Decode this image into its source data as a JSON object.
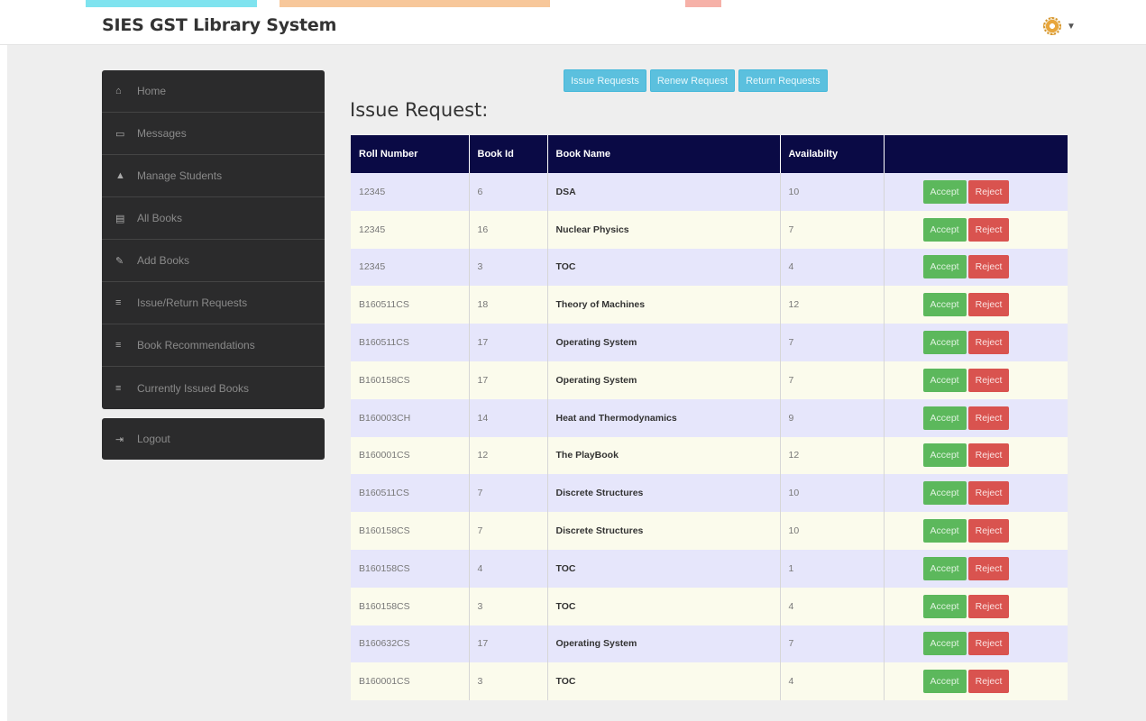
{
  "app": {
    "title": "SIES GST Library System"
  },
  "sidebar": {
    "items": [
      {
        "label": "Home",
        "icon": "home-icon"
      },
      {
        "label": "Messages",
        "icon": "inbox-icon"
      },
      {
        "label": "Manage Students",
        "icon": "user-icon"
      },
      {
        "label": "All Books",
        "icon": "book-icon"
      },
      {
        "label": "Add Books",
        "icon": "edit-icon"
      },
      {
        "label": "Issue/Return Requests",
        "icon": "list-icon"
      },
      {
        "label": "Book Recommendations",
        "icon": "list-icon"
      },
      {
        "label": "Currently Issued Books",
        "icon": "list-icon"
      }
    ],
    "logout": "Logout"
  },
  "tabs": [
    "Issue Requests",
    "Renew Request",
    "Return Requests"
  ],
  "heading": "Issue Request:",
  "table": {
    "columns": [
      "Roll Number",
      "Book Id",
      "Book Name",
      "Availabilty",
      ""
    ],
    "rows": [
      {
        "roll": "12345",
        "book_id": "6",
        "book_name": "DSA",
        "availability": "10"
      },
      {
        "roll": "12345",
        "book_id": "16",
        "book_name": "Nuclear Physics",
        "availability": "7"
      },
      {
        "roll": "12345",
        "book_id": "3",
        "book_name": "TOC",
        "availability": "4"
      },
      {
        "roll": "B160511CS",
        "book_id": "18",
        "book_name": "Theory of Machines",
        "availability": "12"
      },
      {
        "roll": "B160511CS",
        "book_id": "17",
        "book_name": "Operating System",
        "availability": "7"
      },
      {
        "roll": "B160158CS",
        "book_id": "17",
        "book_name": "Operating System",
        "availability": "7"
      },
      {
        "roll": "B160003CH",
        "book_id": "14",
        "book_name": "Heat and Thermodynamics",
        "availability": "9"
      },
      {
        "roll": "B160001CS",
        "book_id": "12",
        "book_name": "The PlayBook",
        "availability": "12"
      },
      {
        "roll": "B160511CS",
        "book_id": "7",
        "book_name": "Discrete Structures",
        "availability": "10"
      },
      {
        "roll": "B160158CS",
        "book_id": "7",
        "book_name": "Discrete Structures",
        "availability": "10"
      },
      {
        "roll": "B160158CS",
        "book_id": "4",
        "book_name": "TOC",
        "availability": "1"
      },
      {
        "roll": "B160158CS",
        "book_id": "3",
        "book_name": "TOC",
        "availability": "4"
      },
      {
        "roll": "B160632CS",
        "book_id": "17",
        "book_name": "Operating System",
        "availability": "7"
      },
      {
        "roll": "B160001CS",
        "book_id": "3",
        "book_name": "TOC",
        "availability": "4"
      }
    ],
    "accept_label": "Accept",
    "reject_label": "Reject"
  },
  "colors": {
    "header_bg": "#0a0a45",
    "sidebar_bg": "#2b2b2c",
    "tab_bg": "#5bc0de",
    "accept": "#5cb85c",
    "reject": "#d9534f",
    "row_odd": "#e6e6fb",
    "row_even": "#fbfbec"
  }
}
